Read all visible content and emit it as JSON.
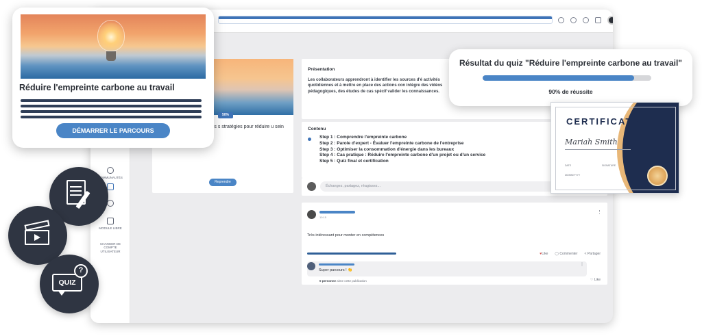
{
  "course_popup": {
    "title": "Réduire l'empreinte carbone au travail",
    "start_button": "DÉMARRER LE PARCOURS"
  },
  "sidebar": {
    "items": [
      {
        "label": "COMMUNAUTÉS",
        "icon": "community-icon"
      },
      {
        "label": "",
        "icon": "graduation-cap-icon"
      },
      {
        "label": "",
        "icon": "users-icon"
      },
      {
        "label": "MODULE LIBRE",
        "icon": "document-icon"
      },
      {
        "label": "CHANGER DE COMPTE UTILISATEUR",
        "icon": "switch-user-icon"
      }
    ]
  },
  "course_card": {
    "progress": "50%",
    "description": "tre sur l'apprentissage des s stratégies pour réduire u sein de l'entreprise.",
    "resume_button": "Reprendre"
  },
  "presentation": {
    "title": "Présentation",
    "text": "Les collaborateurs apprendront à identifier les sources d'é activités quotidiennes et à mettre en place des actions con intègre des vidéos pédagogiques, des études de cas spécif valider les connaissances."
  },
  "contenu": {
    "title": "Contenu",
    "steps": [
      "Step 1 : Comprendre l'empreinte carbone",
      "Step 2 : Parole d'expert - Évaluer l'empreinte carbone de l'entreprise",
      "Step 3 : Optimiser la consommation d'énergie dans les bureaux",
      "Step 4 : Cas pratique : Réduire l'empreinte carbone d'un projet ou d'un service",
      "Step 5 : Quiz final et certification"
    ]
  },
  "feed": {
    "input_placeholder": "Échangez, partagez, réagissez...",
    "post": {
      "time": "10:15",
      "text": "Très intéressant pour monter en compétences",
      "like_label": "Like",
      "comment_label": "Commenter",
      "share_label": "Partager",
      "comment": {
        "text": "Super parcours ! 👏",
        "likes_count": "0 personne",
        "likes_suffix": "aime cette publication",
        "like_label": "Like"
      }
    }
  },
  "quiz_popup": {
    "title": "Résultat du quiz \"Réduire l'empreinte carbone au travail\"",
    "progress": 0.9,
    "result_text": "90% de réussite"
  },
  "certificate": {
    "title": "CERTIFICATE",
    "name": "Mariah Smith",
    "date_label": "DATE",
    "signature_label": "SIGNATURE",
    "date_value": "DD/MM/YYYY"
  },
  "floating_icons": {
    "icons": [
      "document-pencil-icon",
      "video-clapper-icon",
      "quiz-bubble-icon"
    ],
    "quiz_word": "QUIZ",
    "question_mark": "?"
  },
  "colors": {
    "accent": "#4a85c6",
    "dark": "#2f3542",
    "navy": "#1e2d4f",
    "gold": "#e8b778"
  }
}
